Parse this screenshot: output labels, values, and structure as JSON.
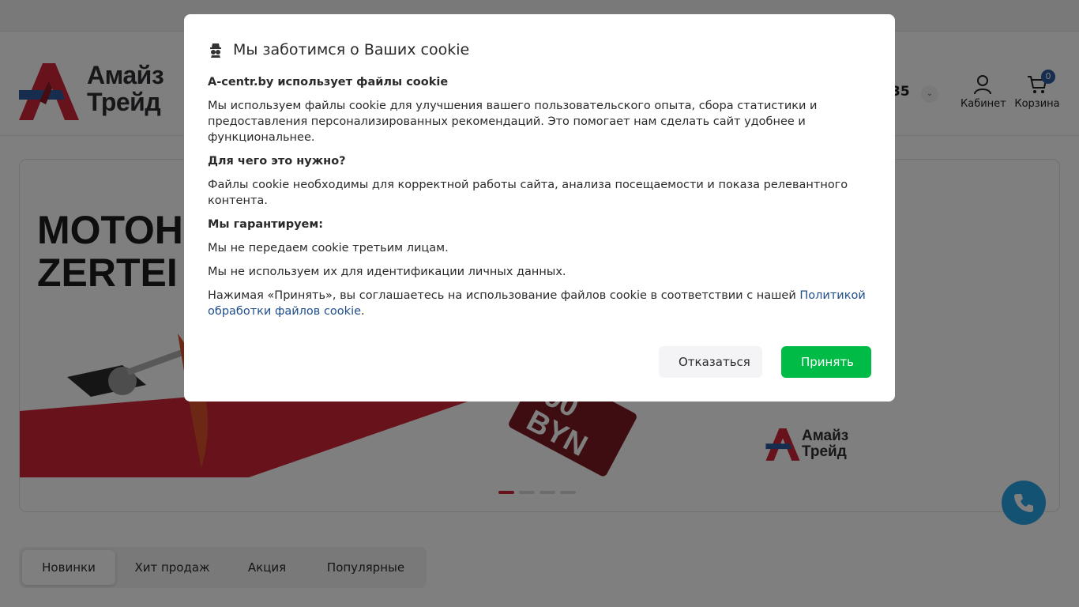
{
  "header": {
    "logo": {
      "line1": "Амайз",
      "line2": "Трейд"
    },
    "phone_fragment": "35",
    "account_label": "Кабинет",
    "cart_label": "Корзина",
    "cart_count": "0"
  },
  "banner": {
    "title_line1": "МОТОН",
    "title_line2": "ZERTEI",
    "price_fragment": "90",
    "currency": "BYN",
    "logo": {
      "line1": "Амайз",
      "line2": "Трейд"
    },
    "slides_total": 4,
    "active_slide": 1
  },
  "tabs": [
    {
      "label": "Новинки",
      "active": true
    },
    {
      "label": "Хит продаж",
      "active": false
    },
    {
      "label": "Акция",
      "active": false
    },
    {
      "label": "Популярные",
      "active": false
    }
  ],
  "cookie_modal": {
    "title": "Мы заботимся о Ваших cookie",
    "heading1": "A-centr.by использует файлы cookie",
    "text1": "Мы используем файлы cookie для улучшения вашего пользовательского опыта, сбора статистики и предоставления персонализированных рекомендаций. Это помогает нам сделать сайт удобнее и функциональнее.",
    "heading2": "Для чего это нужно?",
    "text2": "Файлы cookie необходимы для корректной работы сайта, анализа посещаемости и показа релевантного контента.",
    "heading3": "Мы гарантируем:",
    "guarantee1": "Мы не передаем cookie третьим лицам.",
    "guarantee2": "Мы не используем их для идентификации личных данных.",
    "consent_prefix": "Нажимая «Принять», вы соглашаетесь на использование файлов cookie в соответствии с нашей ",
    "policy_link": "Политикой обработки файлов cookie",
    "consent_suffix": ".",
    "decline_label": "Отказаться",
    "accept_label": "Принять"
  },
  "colors": {
    "brand_red": "#d02737",
    "brand_blue": "#2c5aa0",
    "accept_green": "#00bc47",
    "call_blue": "#29a4e8"
  }
}
